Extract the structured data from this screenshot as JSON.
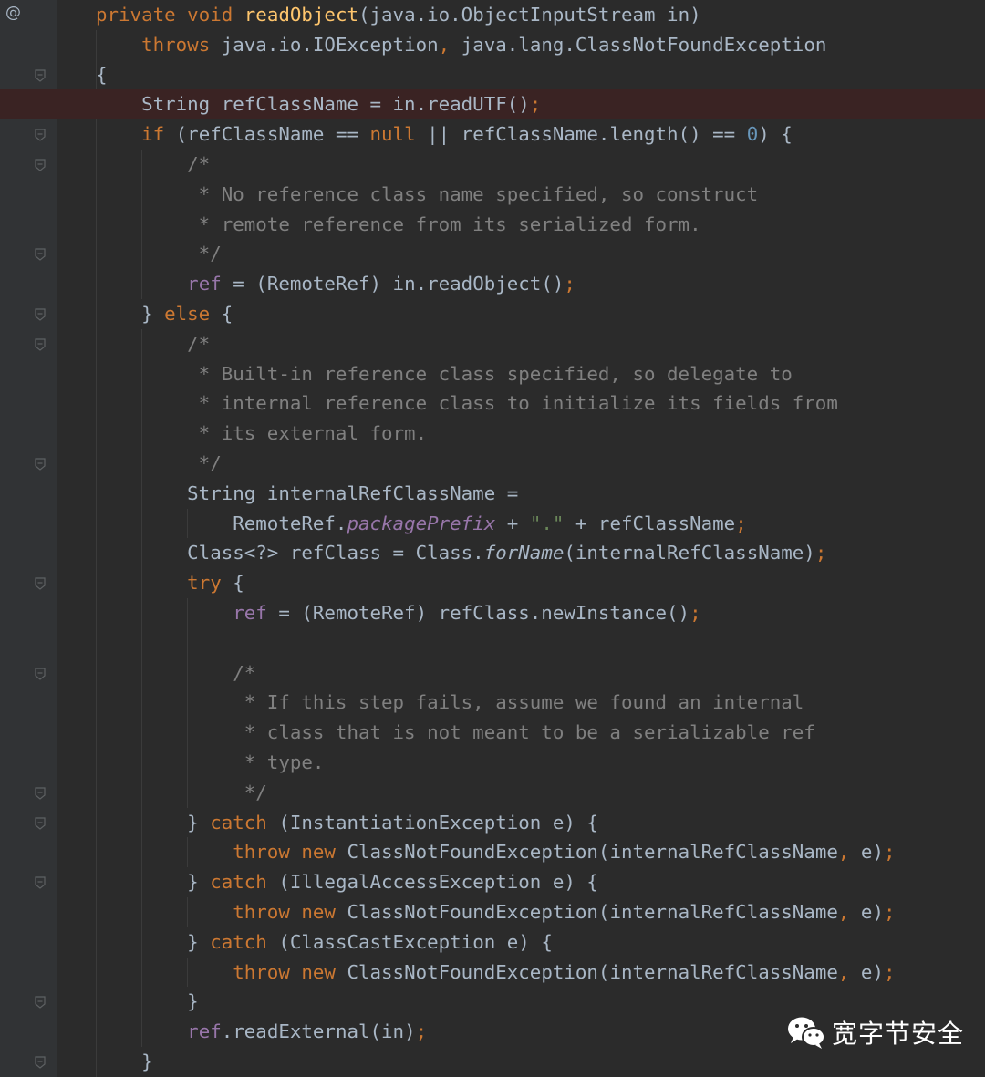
{
  "editor": {
    "gutter_marker": "@",
    "lines": [
      [
        [
          "kw",
          "private "
        ],
        [
          "kw",
          "void "
        ],
        [
          "fn",
          "readObject"
        ],
        [
          "p",
          "(java.io.ObjectInputStream in)"
        ]
      ],
      [
        [
          "p",
          "    "
        ],
        [
          "kw",
          "throws "
        ],
        [
          "p",
          "java.io.IOException"
        ],
        [
          "kw",
          ", "
        ],
        [
          "p",
          "java.lang.ClassNotFoundException"
        ]
      ],
      [
        [
          "p",
          "{"
        ]
      ],
      [
        [
          "p",
          "    String refClassName = in.readUTF()"
        ],
        [
          "kw",
          ";"
        ]
      ],
      [
        [
          "p",
          "    "
        ],
        [
          "kw",
          "if "
        ],
        [
          "p",
          "(refClassName == "
        ],
        [
          "kw",
          "null "
        ],
        [
          "p",
          "|| refClassName.length() == "
        ],
        [
          "num",
          "0"
        ],
        [
          "p",
          ") {"
        ]
      ],
      [
        [
          "cm",
          "        /*"
        ]
      ],
      [
        [
          "cm",
          "         * No reference class name specified, so construct"
        ]
      ],
      [
        [
          "cm",
          "         * remote reference from its serialized form."
        ]
      ],
      [
        [
          "cm",
          "         */"
        ]
      ],
      [
        [
          "p",
          "        "
        ],
        [
          "fld",
          "ref"
        ],
        [
          "p",
          " = (RemoteRef) in.readObject()"
        ],
        [
          "kw",
          ";"
        ]
      ],
      [
        [
          "p",
          "    } "
        ],
        [
          "kw",
          "else "
        ],
        [
          "p",
          "{"
        ]
      ],
      [
        [
          "cm",
          "        /*"
        ]
      ],
      [
        [
          "cm",
          "         * Built-in reference class specified, so delegate to"
        ]
      ],
      [
        [
          "cm",
          "         * internal reference class to initialize its fields from"
        ]
      ],
      [
        [
          "cm",
          "         * its external form."
        ]
      ],
      [
        [
          "cm",
          "         */"
        ]
      ],
      [
        [
          "p",
          "        String internalRefClassName ="
        ]
      ],
      [
        [
          "p",
          "            RemoteRef."
        ],
        [
          "sfld",
          "packagePrefix"
        ],
        [
          "p",
          " + "
        ],
        [
          "str",
          "\".\""
        ],
        [
          "p",
          " + refClassName"
        ],
        [
          "kw",
          ";"
        ]
      ],
      [
        [
          "p",
          "        Class<?> refClass = Class."
        ],
        [
          "sm",
          "forName"
        ],
        [
          "p",
          "(internalRefClassName)"
        ],
        [
          "kw",
          ";"
        ]
      ],
      [
        [
          "p",
          "        "
        ],
        [
          "kw",
          "try "
        ],
        [
          "p",
          "{"
        ]
      ],
      [
        [
          "p",
          "            "
        ],
        [
          "fld",
          "ref"
        ],
        [
          "p",
          " = (RemoteRef) refClass.newInstance()"
        ],
        [
          "kw",
          ";"
        ]
      ],
      [
        [
          "p",
          ""
        ]
      ],
      [
        [
          "cm",
          "            /*"
        ]
      ],
      [
        [
          "cm",
          "             * If this step fails, assume we found an internal"
        ]
      ],
      [
        [
          "cm",
          "             * class that is not meant to be a serializable ref"
        ]
      ],
      [
        [
          "cm",
          "             * type."
        ]
      ],
      [
        [
          "cm",
          "             */"
        ]
      ],
      [
        [
          "p",
          "        } "
        ],
        [
          "kw",
          "catch "
        ],
        [
          "p",
          "(InstantiationException e) {"
        ]
      ],
      [
        [
          "p",
          "            "
        ],
        [
          "kw",
          "throw new "
        ],
        [
          "p",
          "ClassNotFoundException(internalRefClassName"
        ],
        [
          "kw",
          ", "
        ],
        [
          "p",
          "e)"
        ],
        [
          "kw",
          ";"
        ]
      ],
      [
        [
          "p",
          "        } "
        ],
        [
          "kw",
          "catch "
        ],
        [
          "p",
          "(IllegalAccessException e) {"
        ]
      ],
      [
        [
          "p",
          "            "
        ],
        [
          "kw",
          "throw new "
        ],
        [
          "p",
          "ClassNotFoundException(internalRefClassName"
        ],
        [
          "kw",
          ", "
        ],
        [
          "p",
          "e)"
        ],
        [
          "kw",
          ";"
        ]
      ],
      [
        [
          "p",
          "        } "
        ],
        [
          "kw",
          "catch "
        ],
        [
          "p",
          "(ClassCastException e) {"
        ]
      ],
      [
        [
          "p",
          "            "
        ],
        [
          "kw",
          "throw new "
        ],
        [
          "p",
          "ClassNotFoundException(internalRefClassName"
        ],
        [
          "kw",
          ", "
        ],
        [
          "p",
          "e)"
        ],
        [
          "kw",
          ";"
        ]
      ],
      [
        [
          "p",
          "        }"
        ]
      ],
      [
        [
          "p",
          "        "
        ],
        [
          "fld",
          "ref"
        ],
        [
          "p",
          ".readExternal(in)"
        ],
        [
          "kw",
          ";"
        ]
      ],
      [
        [
          "p",
          "    }"
        ]
      ]
    ],
    "breakpoint_line": 4,
    "fold_lines": [
      3,
      5,
      6,
      9,
      11,
      12,
      16,
      20,
      23,
      27,
      28,
      30,
      34,
      36
    ],
    "colors": {
      "background": "#2b2b2b",
      "gutter": "#313335",
      "keyword": "#cc7832",
      "method_declaration": "#ffc66d",
      "comment": "#808080",
      "number": "#6897bb",
      "string": "#6a8759",
      "field": "#9876aa",
      "text": "#a9b7c6",
      "breakpoint": "#c75450",
      "breakpoint_line": "#3a2323"
    }
  },
  "watermark": {
    "icon": "wechat-icon",
    "text": "宽字节安全"
  }
}
